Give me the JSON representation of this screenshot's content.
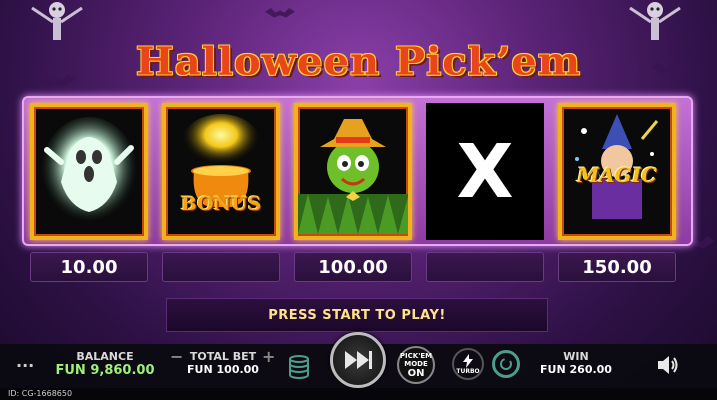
{
  "game": {
    "title": "Halloween Pick’em",
    "message": "PRESS START TO PLAY!",
    "cards": [
      {
        "icon": "ghost-icon",
        "label": ""
      },
      {
        "icon": "bonus-pot-icon",
        "label": "BONUS"
      },
      {
        "icon": "scarecrow-icon",
        "label": ""
      },
      {
        "icon": "x-icon",
        "label": "X"
      },
      {
        "icon": "magic-wizard-icon",
        "label": "MAGIC"
      }
    ],
    "wins": [
      "10.00",
      "",
      "100.00",
      "",
      "150.00"
    ]
  },
  "controls": {
    "menu_label": "...",
    "balance_label": "BALANCE",
    "balance_value": "FUN 9,860.00",
    "minus_label": "−",
    "total_bet_label": "TOTAL BET",
    "plus_label": "+",
    "total_bet_value": "FUN 100.00",
    "pickem_mode_label_1": "PICK'EM",
    "pickem_mode_label_2": "MODE",
    "pickem_mode_state": "ON",
    "turbo_label": "TURBO",
    "win_label": "WIN",
    "win_value": "FUN 260.00"
  },
  "footer": {
    "id_text": "ID: CG-1668650"
  },
  "colors": {
    "accent_gold": "#f0b21d",
    "balance_green": "#9ef07a",
    "message_yellow": "#ffe38a",
    "title_orange": "#e8461a"
  }
}
